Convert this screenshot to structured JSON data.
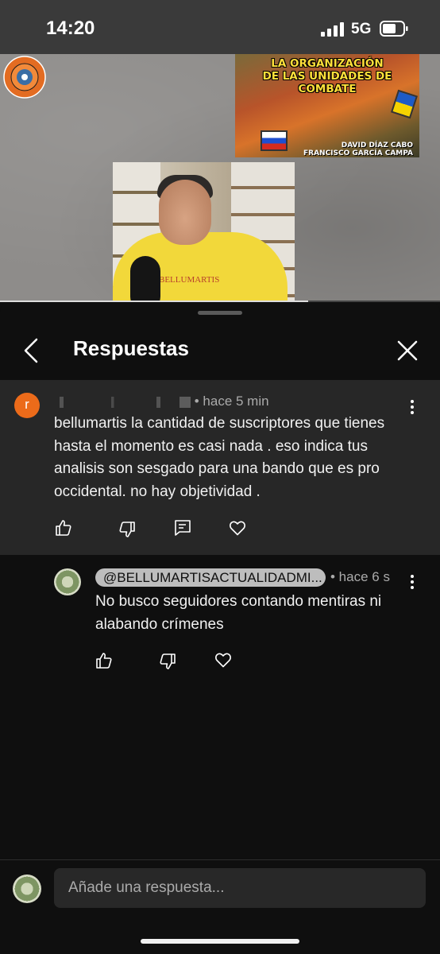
{
  "status_bar": {
    "time": "14:20",
    "network": "5G"
  },
  "video": {
    "thumbnail_title_line1": "LA ORGANIZACIÓN",
    "thumbnail_title_line2": "DE LAS UNIDADES DE COMBATE",
    "thumbnail_author1": "DAVID DÍAZ CABO",
    "thumbnail_author2": "FRANCISCO GARCÍA CAMPA",
    "shirt_text": "BELLUMARTIS",
    "logo_text": "BELLUMARTIS",
    "progress": 0.7
  },
  "panel": {
    "title": "Respuestas"
  },
  "comment": {
    "avatar_letter": "r",
    "time": "• hace 5 min",
    "text": "bellumartis  la cantidad de suscriptores  que tienes hasta el momento  es casi nada  . eso indica  tus analisis son sesgado para una bando que es pro occidental.  no hay objetividad ."
  },
  "reply": {
    "author": "@BELLUMARTISACTUALIDADMI...",
    "time": "• hace 6 s",
    "text": "No busco seguidores contando mentiras ni alabando crímenes"
  },
  "input": {
    "placeholder": "Añade una respuesta..."
  },
  "icons": [
    "back-icon",
    "close-icon",
    "more-vert-icon",
    "like-icon",
    "dislike-icon",
    "reply-icon",
    "heart-icon"
  ]
}
